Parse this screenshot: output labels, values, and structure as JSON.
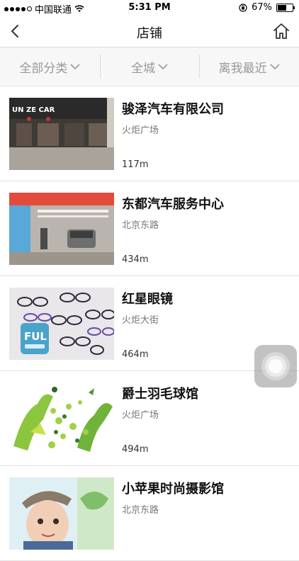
{
  "status_bar": {
    "carrier": "中国联通",
    "time": "5:31 PM",
    "battery": "67%",
    "battery_level": 0.67
  },
  "nav": {
    "title": "店铺"
  },
  "filters": [
    {
      "label": "全部分类"
    },
    {
      "label": "全城"
    },
    {
      "label": "离我最近"
    }
  ],
  "stores": [
    {
      "name": "骏泽汽车有限公司",
      "address": "火炬广场",
      "distance": "117m",
      "thumb_text": "UN ZE CAR"
    },
    {
      "name": "东都汽车服务中心",
      "address": "北京东路",
      "distance": "434m",
      "thumb_text": ""
    },
    {
      "name": "红星眼镜",
      "address": "火炬大街",
      "distance": "464m",
      "thumb_text": "FUL"
    },
    {
      "name": "爵士羽毛球馆",
      "address": "火炬广场",
      "distance": "494m",
      "thumb_text": ""
    },
    {
      "name": "小苹果时尚摄影馆",
      "address": "北京东路",
      "distance": "",
      "thumb_text": ""
    }
  ],
  "colors": {
    "filter_text": "#999999",
    "divider": "#e3e3e3",
    "accent": "#111111"
  },
  "icons": {
    "back": "chevron-left-icon",
    "home": "home-icon",
    "wifi": "wifi-icon",
    "lock": "orientation-lock-icon",
    "battery": "battery-icon",
    "assist": "assistive-touch-icon"
  }
}
